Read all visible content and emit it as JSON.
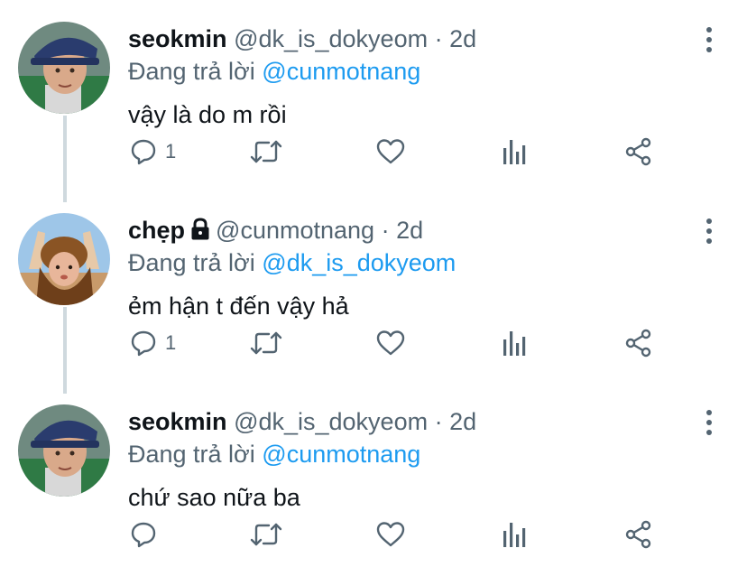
{
  "tweets": [
    {
      "avatar": "seokmin-avatar",
      "name": "seokmin",
      "handle": "@dk_is_dokyeom",
      "separator": "·",
      "time": "2d",
      "locked": false,
      "reply_prefix": "Đang trả lời",
      "reply_to": "@cunmotnang",
      "text": "vậy là do m rồi",
      "reply_count": "1"
    },
    {
      "avatar": "chep-avatar",
      "name": "chẹp",
      "handle": "@cunmotnang",
      "separator": "·",
      "time": "2d",
      "locked": true,
      "reply_prefix": "Đang trả lời",
      "reply_to": "@dk_is_dokyeom",
      "text": "ẻm hận t đến vậy hả",
      "reply_count": "1"
    },
    {
      "avatar": "seokmin-avatar",
      "name": "seokmin",
      "handle": "@dk_is_dokyeom",
      "separator": "·",
      "time": "2d",
      "locked": false,
      "reply_prefix": "Đang trả lời",
      "reply_to": "@cunmotnang",
      "text": "chứ sao nữa ba",
      "reply_count": ""
    }
  ],
  "icons": {
    "reply": "reply-icon",
    "retweet": "retweet-icon",
    "like": "like-icon",
    "analytics": "analytics-icon",
    "share": "share-icon",
    "more": "more-vertical-icon",
    "lock": "lock-icon"
  },
  "colors": {
    "text": "#0f1419",
    "secondary": "#536471",
    "mention": "#1d9bf0",
    "thread_line": "#cfd9de"
  }
}
